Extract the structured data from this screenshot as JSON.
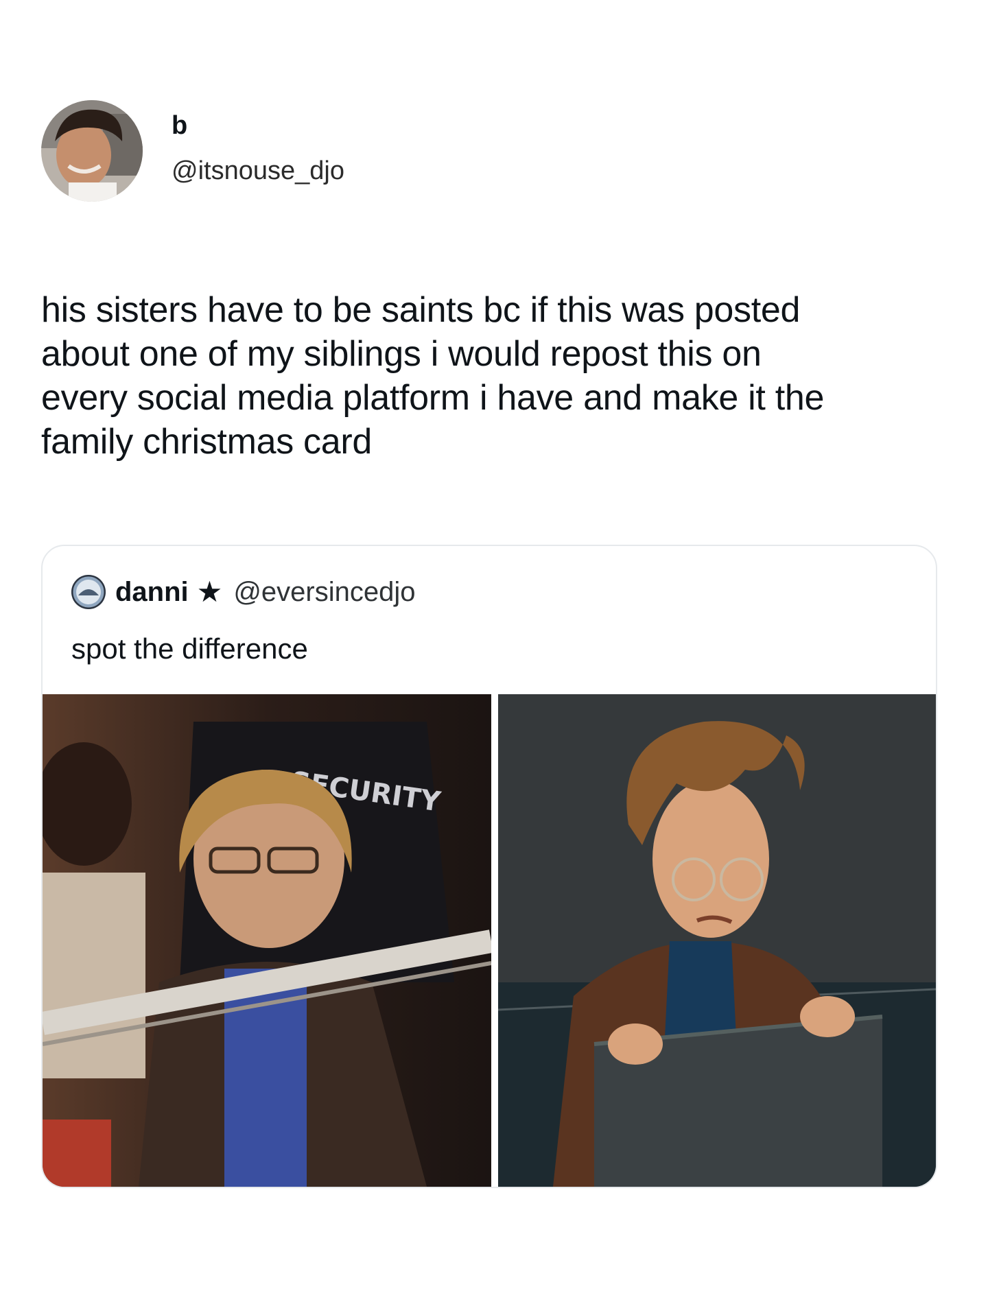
{
  "tweet": {
    "display_name": "b",
    "handle": "@itsnouse_djo",
    "avatar_icon": "profile-photo",
    "text": "his sisters have to be saints bc if this was posted\nabout one of my siblings i would repost this on\nevery social media platform i have and make it the\nfamily christmas card"
  },
  "quote": {
    "display_name": "danni",
    "badge": "★",
    "handle": "@eversincedjo",
    "avatar_icon": "profile-photo",
    "text": "spot the difference",
    "media": [
      {
        "kind": "photo",
        "label": "SECURITY"
      },
      {
        "kind": "animated-still"
      }
    ]
  },
  "colors": {
    "text": "#0f1419",
    "border": "#e6e9ec",
    "background": "#ffffff"
  }
}
